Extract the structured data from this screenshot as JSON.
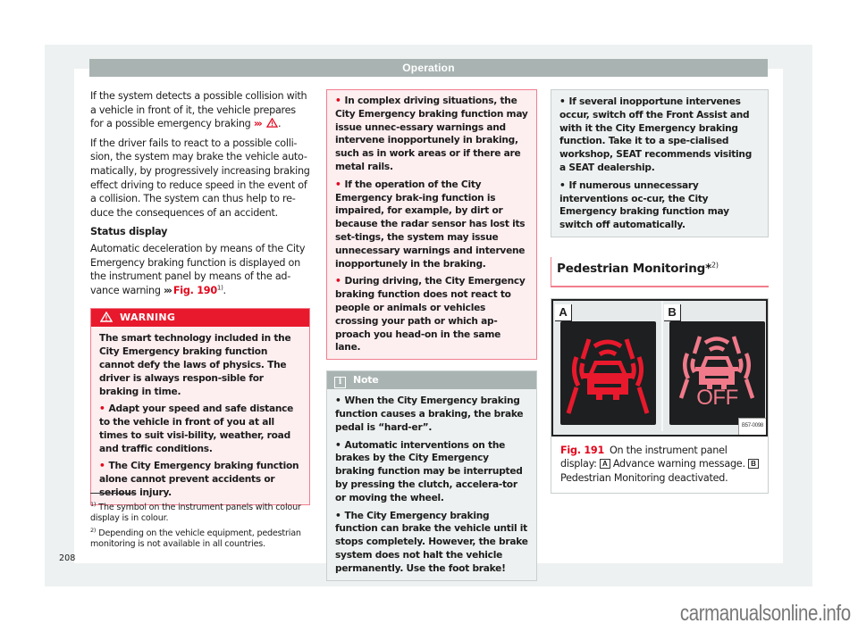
{
  "header": {
    "title": "Operation"
  },
  "column1": {
    "para1": "If the system detects a possible collision with a vehicle in front of it, the vehicle prepares for a possible emergency braking",
    "para1_ref": "›››",
    "para1_end": ".",
    "para2": "If the driver fails to react to a possible colli-sion, the system may brake the vehicle auto-matically, by progressively increasing braking effect driving to reduce speed in the event of a collision. The system can thus help to re-duce the consequences of an accident.",
    "subheading": "Status display",
    "para3": "Automatic deceleration by means of the City Emergency braking function is displayed on the instrument panel by means of the ad-vance warning",
    "para3_ref": "›››",
    "para3_fig": "Fig. 190",
    "para3_sup": "1)",
    "para3_end": ".",
    "warning": {
      "title": "WARNING",
      "intro": "The smart technology included in the City Emergency braking function cannot defy the laws of physics. The driver is always respon-sible for braking in time.",
      "bullets": [
        "Adapt your speed and safe distance to the vehicle in front of you at all times to suit visi-bility, weather, road and traffic conditions.",
        "The City Emergency braking function alone cannot prevent accidents or serious injury."
      ]
    }
  },
  "column2": {
    "warning_continued": [
      "In complex driving situations, the City Emergency braking function may issue unnec-essary warnings and intervene inopportunely in braking, such as in work areas or if there are metal rails.",
      "If the operation of the City Emergency brak-ing function is impaired, for example, by dirt or because the radar sensor has lost its set-tings, the system may issue unnecessary warnings and intervene inopportunely in the braking.",
      "During driving, the City Emergency braking function does not react to people or animals or vehicles crossing your path or which ap-proach you head-on in the same lane."
    ],
    "note": {
      "title": "Note",
      "bullets": [
        "When the City Emergency braking function causes a braking, the brake pedal is “hard-er”.",
        "Automatic interventions on the brakes by the City Emergency braking function may be interrupted by pressing the clutch, accelera-tor or moving the wheel.",
        "The City Emergency braking function can brake the vehicle until it stops completely. However, the brake system does not halt the vehicle permanently. Use the foot brake!"
      ]
    }
  },
  "column3": {
    "note_continued": [
      "If several inopportune intervenes occur, switch off the Front Assist and with it the City Emergency braking function. Take it to a spe-cialised workshop, SEAT recommends visiting a SEAT dealership.",
      "If numerous unnecessary interventions oc-cur, the City Emergency braking function may switch off automatically."
    ],
    "section_title": "Pedestrian Monitoring*",
    "section_sup": "2)",
    "figure": {
      "panel_a_label": "A",
      "panel_b_label": "B",
      "panel_b_text": "OFF",
      "image_code": "B57-0098",
      "fig_number": "Fig. 191",
      "caption_part1": "On the instrument panel display:",
      "caption_label_a": "A",
      "caption_part2": "Advance warning message.",
      "caption_label_b": "B",
      "caption_part3": "Pedestrian Monitoring deactivated.",
      "icon_active_color": "#e8192c",
      "icon_off_color": "#f07a8a"
    }
  },
  "footnotes": [
    {
      "mark": "1)",
      "text": "The symbol on the instrument panels with colour display is in colour."
    },
    {
      "mark": "2)",
      "text": "Depending on the vehicle equipment, pedestrian monitoring is not available in all countries."
    }
  ],
  "page_number": "208",
  "watermark": "carmanualsonline.info",
  "colors": {
    "accent_red": "#e3051b",
    "header_gray": "#a9b4b2",
    "warning_bg": "#fdeef0",
    "note_bg": "#eef1f1"
  }
}
